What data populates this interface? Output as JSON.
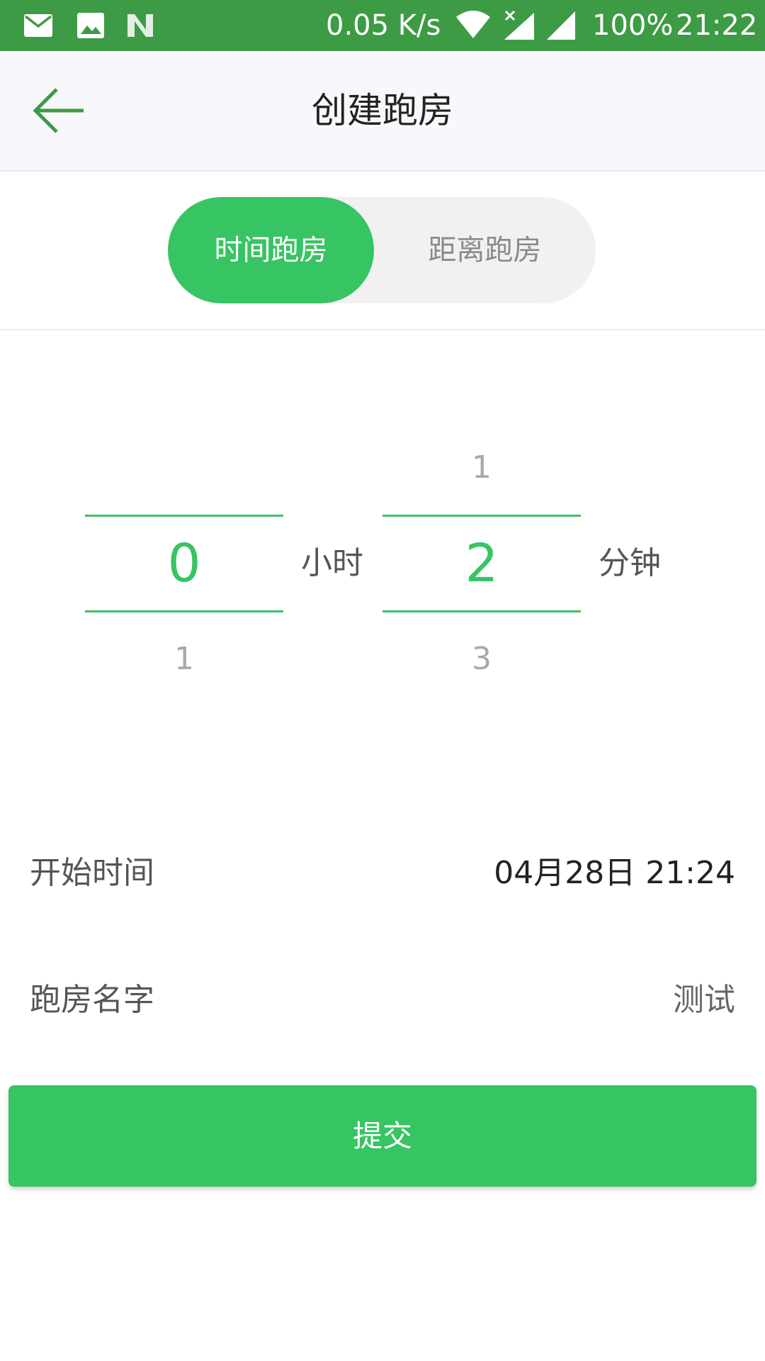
{
  "status_bar": {
    "network_speed": "0.05 K/s",
    "battery": "100%",
    "time": "21:22",
    "icons": [
      "mail-icon",
      "image-icon",
      "notification-n-icon",
      "wifi-icon",
      "signal-no-data-icon",
      "signal-icon"
    ]
  },
  "toolbar": {
    "title": "创建跑房",
    "back_icon": "arrow-left-icon"
  },
  "segment": {
    "tabs": [
      {
        "label": "时间跑房",
        "active": true
      },
      {
        "label": "距离跑房",
        "active": false
      }
    ]
  },
  "duration_picker": {
    "hours": {
      "above": "",
      "selected": "0",
      "below": "1",
      "unit": "小时"
    },
    "minutes": {
      "above": "1",
      "selected": "2",
      "below": "3",
      "unit": "分钟"
    }
  },
  "form": {
    "start_time": {
      "label": "开始时间",
      "value": "04月28日 21:24"
    },
    "room_name": {
      "label": "跑房名字",
      "value": "测试"
    }
  },
  "submit_label": "提交",
  "colors": {
    "status_bar": "#3d9b45",
    "accent": "#37c463",
    "toolbar_bg": "#f8f8fc",
    "segment_bg": "#f1f1f1",
    "dim_text": "#a9a9a9",
    "label_text": "#555555"
  }
}
